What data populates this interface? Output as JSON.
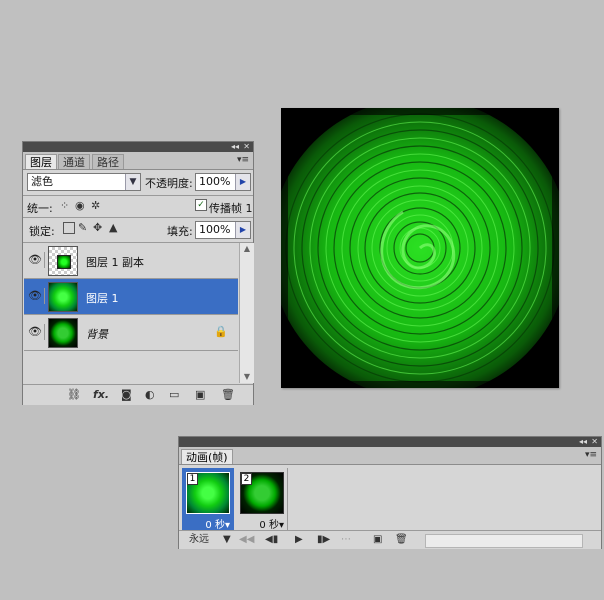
{
  "layers_panel": {
    "tabs": [
      "图层",
      "通道",
      "路径"
    ],
    "blend_mode": "滤色",
    "opacity_label": "不透明度:",
    "opacity_value": "100%",
    "unify_label": "统一:",
    "propagate_label": "传播帧 1",
    "propagate_checked": true,
    "lock_label": "锁定:",
    "fill_label": "填充:",
    "fill_value": "100%",
    "layers": [
      {
        "name": "图层 1 副本",
        "selected": false,
        "locked": false
      },
      {
        "name": "图层 1",
        "selected": true,
        "locked": false
      },
      {
        "name": "背景",
        "selected": false,
        "locked": true
      }
    ]
  },
  "animation_panel": {
    "title": "动画(帧)",
    "frames": [
      {
        "number": "1",
        "delay": "0 秒",
        "selected": true
      },
      {
        "number": "2",
        "delay": "0 秒",
        "selected": false
      }
    ],
    "loop": "永远"
  },
  "icons": {
    "visibility": "eye-icon",
    "lock": "lock-icon",
    "link": "link-icon",
    "fx": "fx-icon",
    "mask": "mask-icon",
    "adjustment": "adjustment-icon",
    "group": "folder-icon",
    "new_layer": "new-layer-icon",
    "delete": "trash-icon"
  },
  "colors": {
    "selection": "#3a6ec4",
    "image_green": "#22d41a"
  }
}
